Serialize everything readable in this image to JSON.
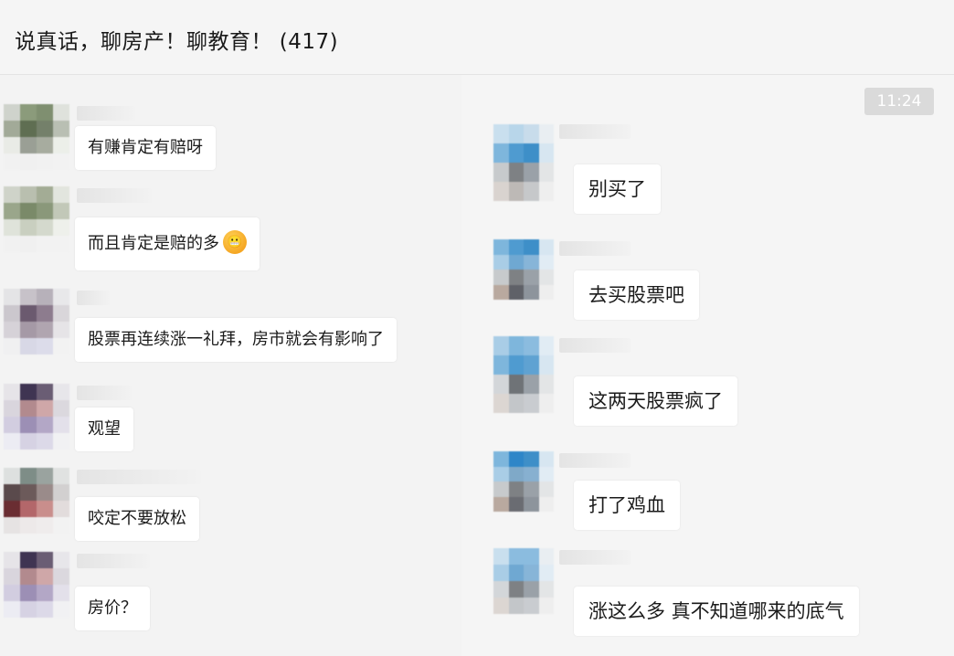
{
  "header": {
    "title": "说真话，聊房产！聊教育！ (417)"
  },
  "time_badge": "11:24",
  "left_messages": [
    {
      "text": "有赚肯定有赔呀"
    },
    {
      "text": "而且肯定是赔的多",
      "emoji_icon": "grimacing-face-icon",
      "emoji_glyph": "😬"
    },
    {
      "text": "股票再连续涨一礼拜，房市就会有影响了"
    },
    {
      "text": "观望"
    },
    {
      "text": "咬定不要放松"
    },
    {
      "text": "房价？"
    }
  ],
  "right_messages": [
    {
      "text": "别买了"
    },
    {
      "text": "去买股票吧"
    },
    {
      "text": "这两天股票疯了"
    },
    {
      "text": "打了鸡血"
    },
    {
      "text": "涨这么多 真不知道哪来的底气"
    }
  ],
  "colors": {
    "background": "#f5f5f5",
    "bubble": "#ffffff",
    "time_badge": "#dadada"
  }
}
